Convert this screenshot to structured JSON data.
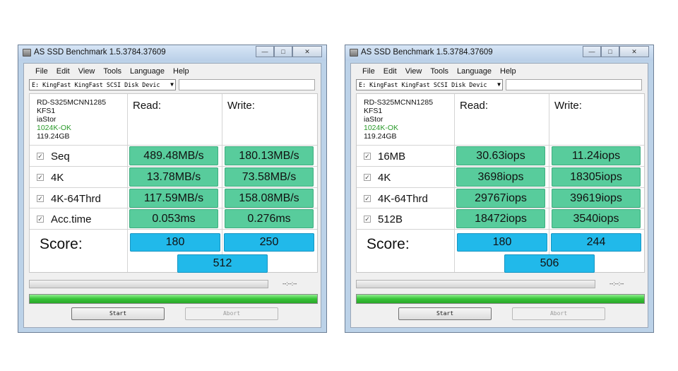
{
  "windows": [
    {
      "title": "AS SSD Benchmark 1.5.3784.37609",
      "menu": [
        "File",
        "Edit",
        "View",
        "Tools",
        "Language",
        "Help"
      ],
      "drive": "E: KingFast KingFast SCSI Disk Devic",
      "info": [
        "RD-S325MCNN1285",
        "KFS1",
        "iaStor",
        "1024K-OK",
        "119.24GB"
      ],
      "read_label": "Read:",
      "write_label": "Write:",
      "rows": [
        {
          "name": "Seq",
          "checked": "✓",
          "read": "489.48MB/s",
          "write": "180.13MB/s"
        },
        {
          "name": "4K",
          "checked": "✓",
          "read": "13.78MB/s",
          "write": "73.58MB/s"
        },
        {
          "name": "4K-64Thrd",
          "checked": "✓",
          "read": "117.59MB/s",
          "write": "158.08MB/s"
        },
        {
          "name": "Acc.time",
          "checked": "✓",
          "read": "0.053ms",
          "write": "0.276ms"
        }
      ],
      "score_label": "Score:",
      "score_read": "180",
      "score_write": "250",
      "score_total": "512",
      "progress_top": 0,
      "time": "--:--:--",
      "progress_bottom": 1.0,
      "start_label": "Start",
      "abort_label": "Abort"
    },
    {
      "title": "AS SSD Benchmark 1.5.3784.37609",
      "menu": [
        "File",
        "Edit",
        "View",
        "Tools",
        "Language",
        "Help"
      ],
      "drive": "E: KingFast KingFast SCSI Disk Devic",
      "info": [
        "RD-S325MCNN1285",
        "KFS1",
        "iaStor",
        "1024K-OK",
        "119.24GB"
      ],
      "read_label": "Read:",
      "write_label": "Write:",
      "rows": [
        {
          "name": "16MB",
          "checked": "✓",
          "read": "30.63iops",
          "write": "11.24iops"
        },
        {
          "name": "4K",
          "checked": "✓",
          "read": "3698iops",
          "write": "18305iops"
        },
        {
          "name": "4K-64Thrd",
          "checked": "✓",
          "read": "29767iops",
          "write": "39619iops"
        },
        {
          "name": "512B",
          "checked": "✓",
          "read": "18472iops",
          "write": "3540iops"
        }
      ],
      "score_label": "Score:",
      "score_read": "180",
      "score_write": "244",
      "score_total": "506",
      "progress_top": 0,
      "time": "--:--:--",
      "progress_bottom": 1.0,
      "start_label": "Start",
      "abort_label": "Abort"
    }
  ],
  "window_buttons": {
    "minimize": "—",
    "maximize": "□",
    "close": "✕"
  },
  "colors": {
    "result_green": "#58cc9c",
    "score_blue": "#21b9ea",
    "progress_green": "#36c236",
    "ok_green": "#2a9a2a"
  }
}
